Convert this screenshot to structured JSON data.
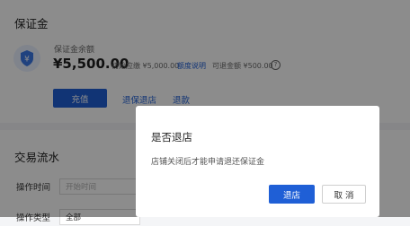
{
  "deposit_section": {
    "title": "保证金",
    "balance_label": "保证金余额",
    "balance_amount": "¥5,500.00",
    "initial_deposit": "初始应缴 ¥5,000.00",
    "amount_help_link": "额度说明",
    "withdrawable": "可退金额 ¥500.00",
    "recharge_button": "充值",
    "refund_withdraw_link": "退保退店",
    "refund_link": "退款"
  },
  "transactions_section": {
    "title": "交易流水",
    "time_label": "操作时间",
    "time_placeholder": "开始时间",
    "type_label": "操作类型",
    "type_value": "全部"
  },
  "dialog": {
    "title": "是否退店",
    "message": "店铺关闭后才能申请退还保证金",
    "confirm_button": "退店",
    "cancel_button": "取 消"
  },
  "colors": {
    "accent": "#1f5fd6",
    "overlay": "rgba(0,0,0,0.45)"
  },
  "icons": {
    "deposit": "shield-yuan-icon",
    "info": "question-circle-icon"
  }
}
